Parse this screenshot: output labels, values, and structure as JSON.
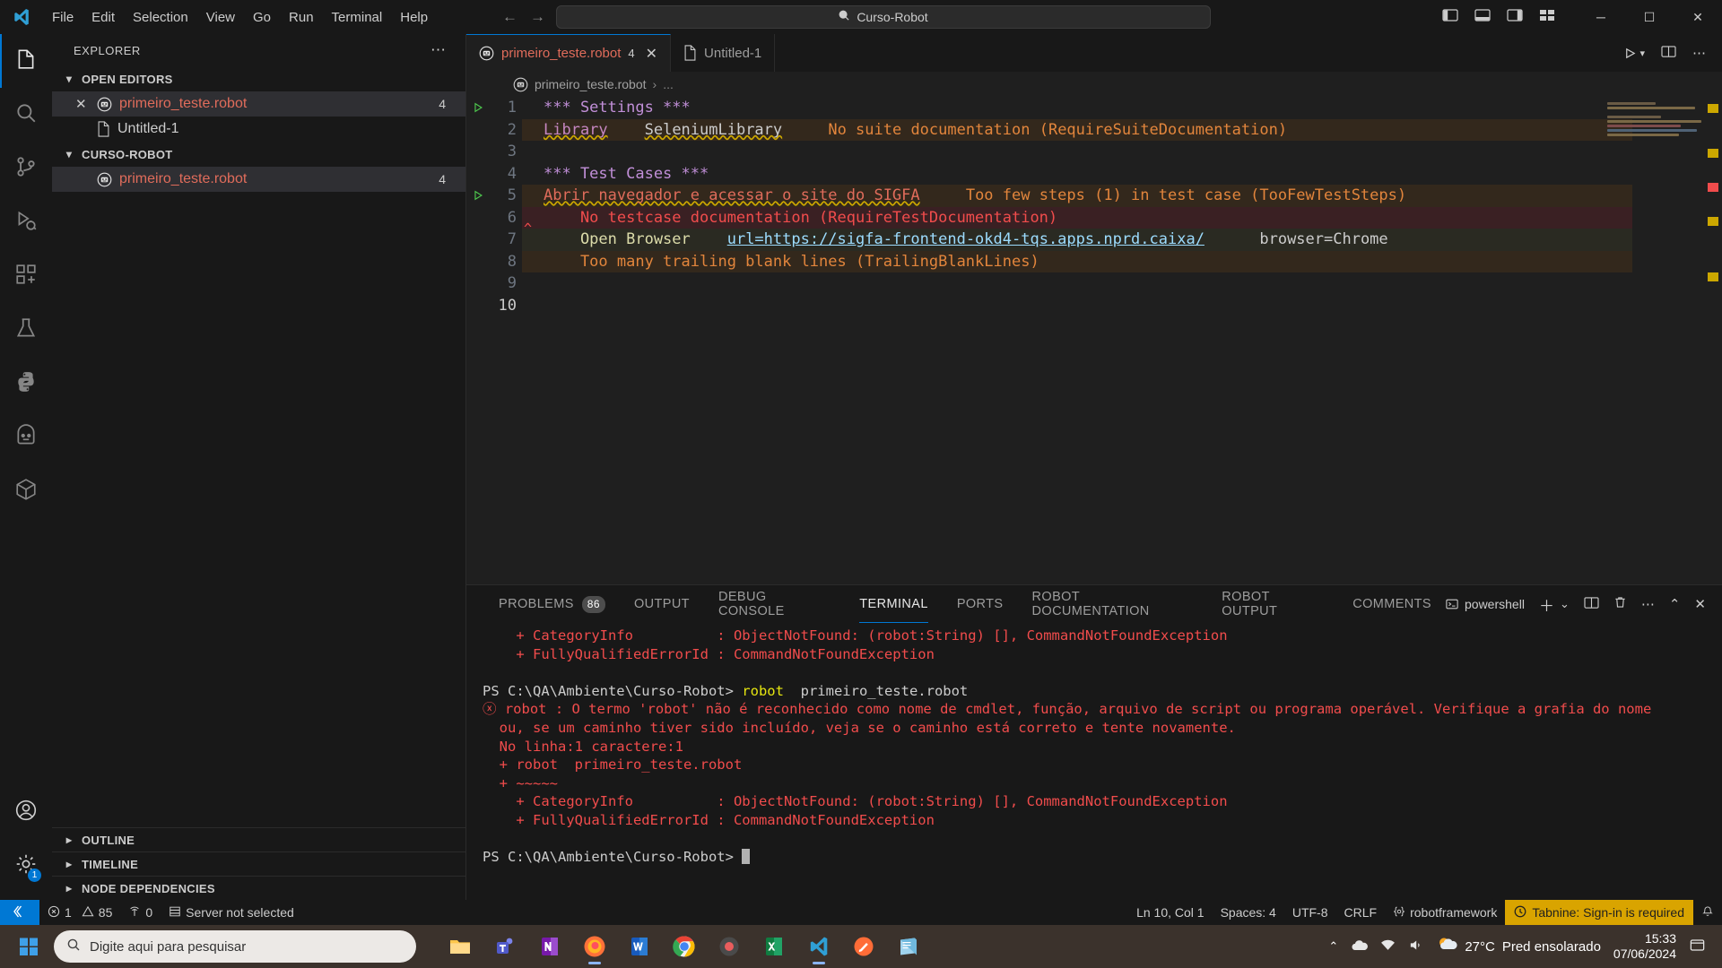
{
  "titlebar": {
    "menu": [
      "File",
      "Edit",
      "Selection",
      "View",
      "Go",
      "Run",
      "Terminal",
      "Help"
    ],
    "command_center": "Curso-Robot",
    "search_icon": "search-icon",
    "window_minimize": "─",
    "window_maximize": "☐",
    "window_close": "✕"
  },
  "activitybar": {
    "items": [
      {
        "name": "explorer",
        "icon": "files-icon"
      },
      {
        "name": "search",
        "icon": "search-icon"
      },
      {
        "name": "source-control",
        "icon": "source-control-icon"
      },
      {
        "name": "run-debug",
        "icon": "run-and-debug-icon"
      },
      {
        "name": "extensions",
        "icon": "extensions-icon"
      },
      {
        "name": "testing",
        "icon": "beaker-icon"
      },
      {
        "name": "python",
        "icon": "python-icon"
      },
      {
        "name": "robot",
        "icon": "robot-framework-icon"
      },
      {
        "name": "package",
        "icon": "package-icon"
      }
    ],
    "bottom": [
      {
        "name": "accounts",
        "icon": "account-icon"
      },
      {
        "name": "manage",
        "icon": "gear-icon",
        "badge": "1"
      }
    ]
  },
  "sidebar": {
    "title": "EXPLORER",
    "more_actions": "⋯",
    "sections": [
      {
        "label": "OPEN EDITORS",
        "expanded": true,
        "items": [
          {
            "label": "primeiro_teste.robot",
            "icon": "robot-file-icon",
            "badge": "4",
            "selected": true,
            "close": "✕",
            "error": true
          },
          {
            "label": "Untitled-1",
            "icon": "plain-file-icon",
            "badge": "",
            "selected": false,
            "close": "",
            "error": false
          }
        ]
      },
      {
        "label": "CURSO-ROBOT",
        "expanded": true,
        "items": [
          {
            "label": "primeiro_teste.robot",
            "icon": "robot-file-icon",
            "badge": "4",
            "selected": true,
            "close": "",
            "error": true
          }
        ]
      }
    ],
    "collapsed_sections": [
      "OUTLINE",
      "TIMELINE",
      "NODE DEPENDENCIES"
    ]
  },
  "editor": {
    "tabs": [
      {
        "label": "primeiro_teste.robot",
        "count": "4",
        "active": true,
        "icon": "robot-file-icon",
        "close": "✕"
      },
      {
        "label": "Untitled-1",
        "count": "",
        "active": false,
        "icon": "plain-file-icon",
        "close": ""
      }
    ],
    "toolbar": {
      "run_label": "run-and-debug-icon",
      "split_label": "split-editor-icon",
      "more_label": "⋯"
    },
    "breadcrumb": [
      "primeiro_teste.robot",
      "›",
      "..."
    ],
    "lines": [
      {
        "num": "1",
        "glyph": "run-test-icon",
        "bg": "none",
        "tokens": [
          {
            "t": "*** Settings ***",
            "c": "t-head"
          }
        ]
      },
      {
        "num": "2",
        "glyph": "",
        "bg": "bg-warn",
        "tokens": [
          {
            "t": "Library",
            "c": "t-kw squig"
          },
          {
            "t": "    ",
            "c": "t-plain"
          },
          {
            "t": "SeleniumLibrary",
            "c": "t-lib squig"
          },
          {
            "t": "     ",
            "c": "t-plain"
          },
          {
            "t": "No suite documentation (RequireSuiteDocumentation)",
            "c": "t-warn"
          }
        ]
      },
      {
        "num": "3",
        "glyph": "",
        "bg": "none",
        "tokens": []
      },
      {
        "num": "4",
        "glyph": "",
        "bg": "none",
        "tokens": [
          {
            "t": "*** Test Cases ***",
            "c": "t-head"
          }
        ]
      },
      {
        "num": "5",
        "glyph": "run-test-icon",
        "bg": "bg-warn",
        "tokens": [
          {
            "t": "Abrir navegador e acessar o site do SIGFA",
            "c": "t-name squig"
          },
          {
            "t": "     ",
            "c": "t-plain"
          },
          {
            "t": "Too few steps (1) in test case (TooFewTestSteps)",
            "c": "t-warn"
          }
        ]
      },
      {
        "num": "6",
        "glyph": "",
        "bg": "bg-err",
        "tokens": [
          {
            "t": "    No testcase documentation (RequireTestDocumentation)",
            "c": "t-err"
          }
        ]
      },
      {
        "num": "7",
        "glyph": "",
        "bg": "bg-sel",
        "tokens": [
          {
            "t": "    Open Browser",
            "c": "t-kwd"
          },
          {
            "t": "    ",
            "c": "t-plain"
          },
          {
            "t": "url=https://sigfa-frontend-okd4-tqs.apps.nprd.caixa/",
            "c": "t-arg uline"
          },
          {
            "t": "      ",
            "c": "t-plain"
          },
          {
            "t": "browser=Chrome",
            "c": "t-plain"
          }
        ]
      },
      {
        "num": "8",
        "glyph": "",
        "bg": "bg-warn",
        "tokens": [
          {
            "t": "    Too many trailing blank lines (TrailingBlankLines)",
            "c": "t-warn"
          }
        ]
      },
      {
        "num": "9",
        "glyph": "",
        "bg": "none",
        "tokens": []
      },
      {
        "num": "10",
        "glyph": "",
        "bg": "none",
        "current": true,
        "tokens": []
      }
    ]
  },
  "panel": {
    "tabs": [
      {
        "label": "PROBLEMS",
        "count": "86",
        "active": false
      },
      {
        "label": "OUTPUT",
        "count": "",
        "active": false
      },
      {
        "label": "DEBUG CONSOLE",
        "count": "",
        "active": false
      },
      {
        "label": "TERMINAL",
        "count": "",
        "active": true
      },
      {
        "label": "PORTS",
        "count": "",
        "active": false
      },
      {
        "label": "ROBOT DOCUMENTATION",
        "count": "",
        "active": false
      },
      {
        "label": "ROBOT OUTPUT",
        "count": "",
        "active": false
      },
      {
        "label": "COMMENTS",
        "count": "",
        "active": false
      }
    ],
    "shell": "powershell",
    "actions": {
      "new_terminal": "＋",
      "dropdown": "⌄",
      "split": "split-terminal-icon",
      "kill": "trash-icon",
      "more": "⋯",
      "maximize": "⌃",
      "close": "✕"
    },
    "terminal_lines": [
      {
        "segs": [
          {
            "t": "    + CategoryInfo          : ObjectNotFound: (robot:String) [], CommandNotFoundException",
            "c": "red"
          }
        ]
      },
      {
        "segs": [
          {
            "t": "    + FullyQualifiedErrorId : CommandNotFoundException",
            "c": "red"
          }
        ]
      },
      {
        "segs": [
          {
            "t": "",
            "c": ""
          }
        ]
      },
      {
        "segs": [
          {
            "t": "PS C:\\QA\\Ambiente\\Curso-Robot> ",
            "c": ""
          },
          {
            "t": "robot",
            "c": "yellow"
          },
          {
            "t": "  primeiro_teste.robot",
            "c": ""
          }
        ]
      },
      {
        "segs": [
          {
            "t": "ⓧ",
            "c": "errmark"
          },
          {
            "t": " robot : O termo 'robot' não é reconhecido como nome de cmdlet, função, arquivo de script ou programa operável. Verifique a grafia do nome",
            "c": "red"
          }
        ]
      },
      {
        "segs": [
          {
            "t": "  ou, se um caminho tiver sido incluído, veja se o caminho está correto e tente novamente.",
            "c": "red"
          }
        ]
      },
      {
        "segs": [
          {
            "t": "  No linha:1 caractere:1",
            "c": "red"
          }
        ]
      },
      {
        "segs": [
          {
            "t": "  + robot  primeiro_teste.robot",
            "c": "red"
          }
        ]
      },
      {
        "segs": [
          {
            "t": "  + ~~~~~",
            "c": "red"
          }
        ]
      },
      {
        "segs": [
          {
            "t": "    + CategoryInfo          : ObjectNotFound: (robot:String) [], CommandNotFoundException",
            "c": "red"
          }
        ]
      },
      {
        "segs": [
          {
            "t": "    + FullyQualifiedErrorId : CommandNotFoundException",
            "c": "red"
          }
        ]
      },
      {
        "segs": [
          {
            "t": "",
            "c": ""
          }
        ]
      },
      {
        "segs": [
          {
            "t": "PS C:\\QA\\Ambiente\\Curso-Robot> ",
            "c": ""
          },
          {
            "t": "█",
            "c": "cursor"
          }
        ]
      }
    ]
  },
  "statusbar": {
    "remote_icon": "remote-window-icon",
    "errors": "1",
    "warnings": "85",
    "ports": "0",
    "server": "Server not selected",
    "position": "Ln 10, Col 1",
    "spaces": "Spaces: 4",
    "encoding": "UTF-8",
    "eol": "CRLF",
    "language": "robotframework",
    "tabnine": "Tabnine: Sign-in is required",
    "bell": "bell-icon"
  },
  "taskbar": {
    "search_placeholder": "Digite aqui para pesquisar",
    "apps": [
      {
        "name": "file-explorer",
        "active": false
      },
      {
        "name": "microsoft-teams",
        "active": false
      },
      {
        "name": "onenote",
        "active": false
      },
      {
        "name": "firefox",
        "active": true
      },
      {
        "name": "microsoft-word",
        "active": false
      },
      {
        "name": "google-chrome",
        "active": false
      },
      {
        "name": "recording-app",
        "active": false
      },
      {
        "name": "microsoft-excel",
        "active": false
      },
      {
        "name": "visual-studio-code",
        "active": true
      },
      {
        "name": "postman",
        "active": false
      },
      {
        "name": "notepad",
        "active": false
      }
    ],
    "weather_temp": "27°C",
    "weather_desc": "Pred ensolarado",
    "time": "15:33",
    "date": "07/06/2024",
    "tray_chevron": "⌃",
    "notifications": "notification-icon"
  }
}
